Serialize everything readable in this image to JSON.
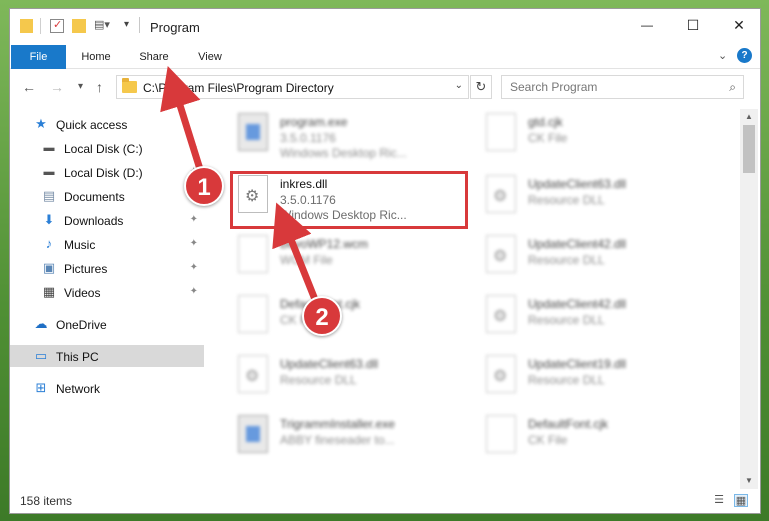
{
  "window": {
    "title": "Program",
    "minimize": "—",
    "maximize": "☐",
    "close": "✕"
  },
  "ribbon": {
    "tabs": [
      "File",
      "Home",
      "Share",
      "View"
    ],
    "expand": "⌄",
    "help": "?"
  },
  "nav": {
    "back": "←",
    "forward": "→",
    "recent": "▾",
    "up": "↑",
    "address": "C:\\Program Files\\Program Directory",
    "address_caret": "⌄",
    "refresh": "↻",
    "search_placeholder": "Search Program",
    "search_icon": "⌕"
  },
  "sidebar": {
    "items": [
      {
        "label": "Quick access",
        "icon": "star-icon"
      },
      {
        "label": "Local Disk (C:)",
        "icon": "drive-icon"
      },
      {
        "label": "Local Disk (D:)",
        "icon": "drive-icon"
      },
      {
        "label": "Documents",
        "icon": "documents-icon"
      },
      {
        "label": "Downloads",
        "icon": "download-icon"
      },
      {
        "label": "Music",
        "icon": "music-icon"
      },
      {
        "label": "Pictures",
        "icon": "pictures-icon"
      },
      {
        "label": "Videos",
        "icon": "videos-icon"
      },
      {
        "label": "OneDrive",
        "icon": "cloud-icon"
      },
      {
        "label": "This PC",
        "icon": "computer-icon"
      },
      {
        "label": "Network",
        "icon": "network-icon"
      }
    ]
  },
  "files": {
    "left": [
      {
        "name": "program.exe",
        "sub1": "3.5.0.1176",
        "sub2": "Windows Desktop Ric..."
      },
      {
        "name": "inkres.dll",
        "sub1": "3.5.0.1176",
        "sub2": "Windows Desktop Ric..."
      },
      {
        "name": "BevoWP12.wcm",
        "sub1": "WCM File",
        "sub2": ""
      },
      {
        "name": "DefaultFont.cjk",
        "sub1": "CK File",
        "sub2": ""
      },
      {
        "name": "UpdateClient63.dll",
        "sub1": "Resource DLL",
        "sub2": ""
      },
      {
        "name": "TrigrammInstaller.exe",
        "sub1": "ABBY fineseader to...",
        "sub2": ""
      }
    ],
    "right": [
      {
        "name": "gtd.cjk",
        "sub1": "CK File",
        "sub2": ""
      },
      {
        "name": "UpdateClient63.dll",
        "sub1": "Resource DLL",
        "sub2": ""
      },
      {
        "name": "UpdateClient42.dll",
        "sub1": "Resource DLL",
        "sub2": ""
      },
      {
        "name": "UpdateClient42.dll",
        "sub1": "Resource DLL",
        "sub2": ""
      },
      {
        "name": "UpdateClient19.dll",
        "sub1": "Resource DLL",
        "sub2": ""
      },
      {
        "name": "DefaultFont.cjk",
        "sub1": "CK File",
        "sub2": ""
      }
    ]
  },
  "status": {
    "count": "158 items"
  },
  "annotations": {
    "badge1": "1",
    "badge2": "2"
  },
  "colors": {
    "accent": "#1979ca",
    "annotation": "#d8393b",
    "selection": "#cce8ff"
  }
}
